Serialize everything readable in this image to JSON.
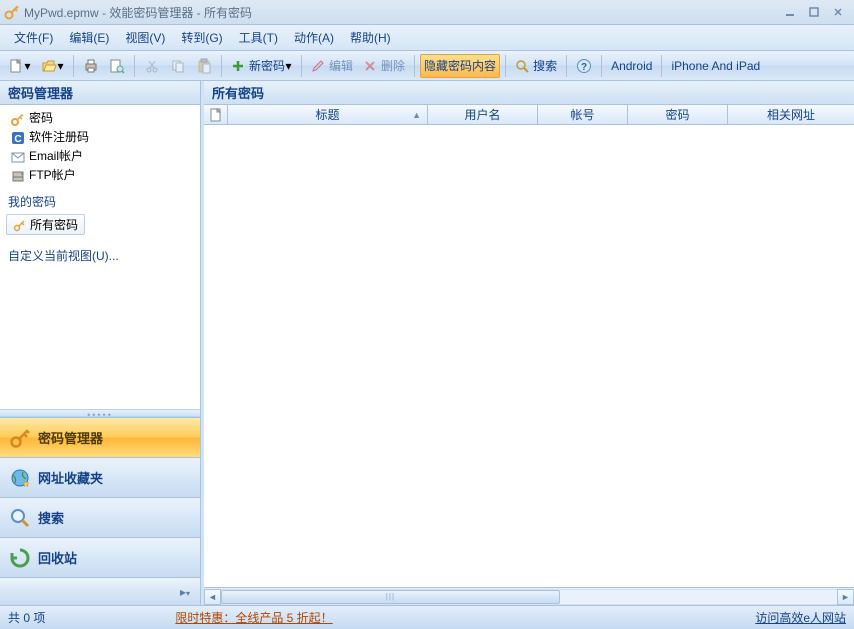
{
  "title": "MyPwd.epmw - 效能密码管理器 - 所有密码",
  "menu": [
    "文件(F)",
    "编辑(E)",
    "视图(V)",
    "转到(G)",
    "工具(T)",
    "动作(A)",
    "帮助(H)"
  ],
  "toolbar": {
    "new_pwd": "新密码",
    "edit": "编辑",
    "delete": "删除",
    "hide_pwd": "隐藏密码内容",
    "search": "搜索",
    "android": "Android",
    "iphone": "iPhone And iPad"
  },
  "sidebar": {
    "header": "密码管理器",
    "tree": [
      "密码",
      "软件注册码",
      "Email帐户",
      "FTP帐户"
    ],
    "my_pwd_label": "我的密码",
    "all_pwd_pill": "所有密码",
    "custom_view": "自定义当前视图(U)..."
  },
  "nav": {
    "manager": "密码管理器",
    "favorites": "网址收藏夹",
    "search": "搜索",
    "recycle": "回收站"
  },
  "content": {
    "header": "所有密码",
    "columns": [
      "",
      "标题",
      "用户名",
      "帐号",
      "密码",
      "相关网址"
    ]
  },
  "status": {
    "count": "共 0 项",
    "promo": "限时特惠：全线产品 5 折起！",
    "link": "访问高效e人网站"
  }
}
